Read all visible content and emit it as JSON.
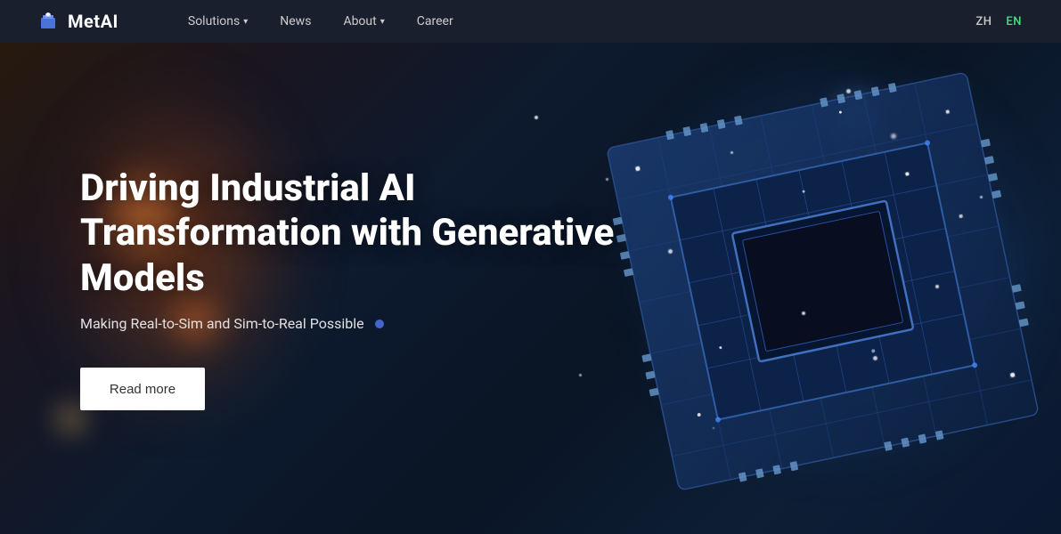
{
  "brand": {
    "name": "MetAI",
    "logo_alt": "MetAI logo"
  },
  "navbar": {
    "links": [
      {
        "id": "solutions",
        "label": "Solutions",
        "hasDropdown": true
      },
      {
        "id": "news",
        "label": "News",
        "hasDropdown": false
      },
      {
        "id": "about",
        "label": "About",
        "hasDropdown": true
      },
      {
        "id": "career",
        "label": "Career",
        "hasDropdown": false
      }
    ],
    "languages": [
      {
        "code": "ZH",
        "active": false
      },
      {
        "code": "EN",
        "active": true
      }
    ]
  },
  "hero": {
    "title": "Driving Industrial AI Transformation with Generative Models",
    "subtitle": "Making Real-to-Sim and Sim-to-Real Possible",
    "cta_label": "Read more"
  }
}
